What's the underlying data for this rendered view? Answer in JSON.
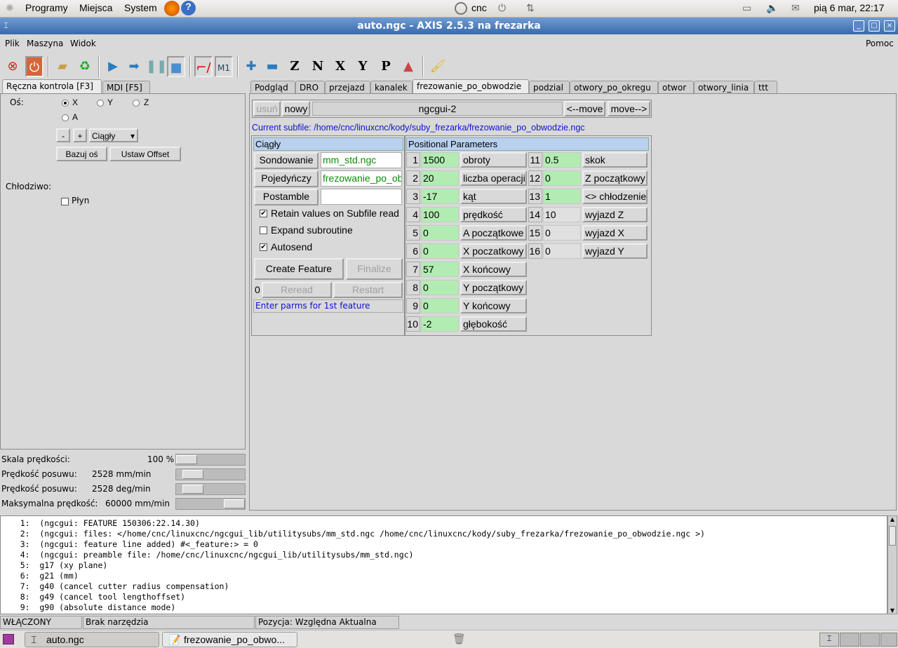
{
  "top_panel": {
    "menus": [
      "Programy",
      "Miejsca",
      "System"
    ],
    "host": "cnc",
    "clock": "pią  6 mar, 22:17"
  },
  "window": {
    "title": "auto.ngc - AXIS 2.5.3 na frezarka"
  },
  "menu": {
    "items": [
      "Plik",
      "Maszyna",
      "Widok"
    ],
    "help": "Pomoc"
  },
  "toolbar": [
    "estop-icon",
    "power-icon",
    "open-icon",
    "reload-icon",
    "run-icon",
    "step-icon",
    "pause-icon",
    "stop-icon",
    "block-delete-icon",
    "optional-stop-icon",
    "zoom-in-icon",
    "zoom-out-icon",
    "view-z-icon",
    "view-z2-icon",
    "view-x-icon",
    "view-y-icon",
    "view-p-icon",
    "rotate-icon",
    "clear-icon"
  ],
  "left": {
    "tabs": [
      "Ręczna kontrola [F3]",
      "MDI [F5]"
    ],
    "axis_label": "Oś:",
    "axes": [
      "X",
      "Y",
      "Z",
      "A"
    ],
    "selected_axis": "X",
    "minus": "-",
    "plus": "+",
    "jog_mode": "Ciągły",
    "home_button": "Bazuj oś",
    "offset_button": "Ustaw Offset",
    "coolant_label": "Chłodziwo:",
    "flood": "Płyn",
    "flood_checked": false
  },
  "sliders": [
    {
      "label": "Skala prędkości:",
      "value": "100 %",
      "fraction": 0.0
    },
    {
      "label": "Prędkość posuwu:",
      "value": "2528 mm/min",
      "fraction": 0.13
    },
    {
      "label": "Prędkość posuwu:",
      "value": "2528 deg/min",
      "fraction": 0.13
    },
    {
      "label": "Maksymalna prędkość:",
      "value": "60000 mm/min",
      "fraction": 1.0
    }
  ],
  "right": {
    "tabs": [
      "Podgląd",
      "DRO",
      "przejazd",
      "kanalek",
      "frezowanie_po_obwodzie",
      "podzial",
      "otwory_po_okregu",
      "otwor",
      "otwory_linia",
      "ttt"
    ],
    "active_tab": "frezowanie_po_obwodzie"
  },
  "ngcgui": {
    "delete": "usuń",
    "new": "nowy",
    "name": "ngcgui-2",
    "move_left": "<--move",
    "move_right": "move-->",
    "subfile": "Current subfile: /home/cnc/linuxcnc/kody/suby_frezarka/frezowanie_po_obwodzie.ngc",
    "mode_header": "Ciągły",
    "files": [
      {
        "button": "Sondowanie",
        "value": "mm_std.ngc"
      },
      {
        "button": "Pojedyńczy",
        "value": "frezowanie_po_obwodzie.ngc"
      },
      {
        "button": "Postamble",
        "value": ""
      }
    ],
    "options": [
      {
        "label": "Retain values on Subfile read",
        "checked": true
      },
      {
        "label": "Expand subroutine",
        "checked": false
      },
      {
        "label": "Autosend",
        "checked": true
      }
    ],
    "create": "Create Feature",
    "finalize": "Finalize",
    "count": "0",
    "reread": "Reread",
    "restart": "Restart",
    "message": "Enter parms for 1st feature",
    "params_header": "Positional Parameters",
    "params": [
      {
        "n": "1",
        "v": "1500",
        "l": "obroty"
      },
      {
        "n": "2",
        "v": "20",
        "l": "liczba operacji"
      },
      {
        "n": "3",
        "v": "-17",
        "l": "kąt"
      },
      {
        "n": "4",
        "v": "100",
        "l": "prędkość"
      },
      {
        "n": "5",
        "v": "0",
        "l": "A początkowe"
      },
      {
        "n": "6",
        "v": "0",
        "l": "X poczatkowy"
      },
      {
        "n": "7",
        "v": "57",
        "l": "X końcowy"
      },
      {
        "n": "8",
        "v": "0",
        "l": "Y początkowy"
      },
      {
        "n": "9",
        "v": "0",
        "l": "Y końcowy"
      },
      {
        "n": "10",
        "v": "-2",
        "l": "głębokość"
      },
      {
        "n": "11",
        "v": "0.5",
        "l": "skok"
      },
      {
        "n": "12",
        "v": "0",
        "l": "Z początkowy"
      },
      {
        "n": "13",
        "v": "1",
        "l": "<> chłodzenie"
      },
      {
        "n": "14",
        "v": "10",
        "l": "wyjazd Z"
      },
      {
        "n": "15",
        "v": "0",
        "l": "wyjazd X"
      },
      {
        "n": "16",
        "v": "0",
        "l": "wyjazd Y"
      }
    ]
  },
  "code": [
    "    1:  (ngcgui: FEATURE 150306:22.14.30)",
    "    2:  (ngcgui: files: </home/cnc/linuxcnc/ngcgui_lib/utilitysubs/mm_std.ngc /home/cnc/linuxcnc/kody/suby_frezarka/frezowanie_po_obwodzie.ngc >)",
    "    3:  (ngcgui: feature line added) #<_feature:> = 0",
    "    4:  (ngcgui: preamble file: /home/cnc/linuxcnc/ngcgui_lib/utilitysubs/mm_std.ngc)",
    "    5:  g17 (xy plane)",
    "    6:  g21 (mm)",
    "    7:  g40 (cancel cutter radius compensation)",
    "    8:  g49 (cancel tool lengthoffset)",
    "    9:  g90 (absolute distance mode)"
  ],
  "status": {
    "state": "WŁĄCZONY",
    "tool": "Brak narzędzia",
    "position": "Pozycja: Względna Aktualna"
  },
  "taskbar": [
    "auto.ngc",
    "frezowanie_po_obwo..."
  ],
  "colors": {
    "param_value": "#b2ecb2",
    "header": "#b9d1ee",
    "link_text": "#1010d0",
    "file_text": "#079007",
    "titlebar": "#3a6aaa"
  }
}
